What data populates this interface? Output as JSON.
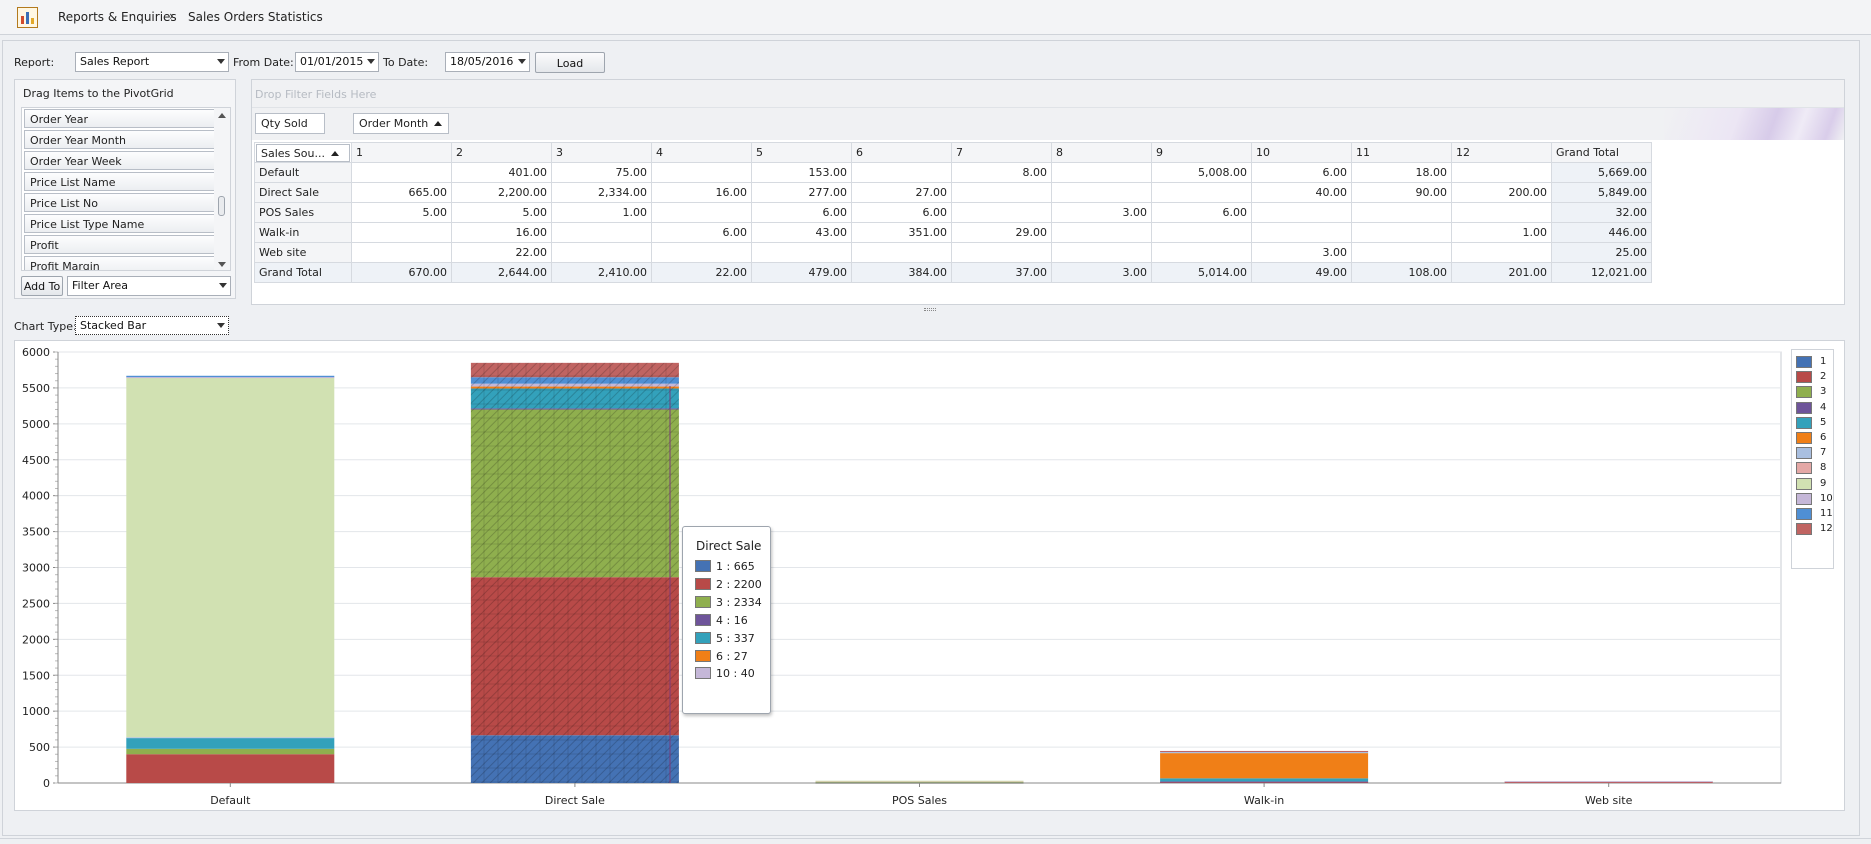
{
  "breadcrumb": {
    "root": "Reports & Enquiries",
    "separator": "›",
    "current": "Sales Orders Statistics"
  },
  "filters": {
    "report_label": "Report:",
    "report_value": "Sales Report",
    "from_label": "From Date:",
    "from_value": "01/01/2015",
    "to_label": "To Date:",
    "to_value": "18/05/2016",
    "load_label": "Load"
  },
  "field_list": {
    "title": "Drag Items to the PivotGrid",
    "items": [
      "Order Year",
      "Order Year Month",
      "Order Year Week",
      "Price List Name",
      "Price List No",
      "Price List Type Name",
      "Profit",
      "Profit Margin"
    ],
    "add_label": "Add To",
    "area_value": "Filter Area"
  },
  "pivot": {
    "filter_placeholder": "Drop Filter Fields Here",
    "data_field": "Qty Sold",
    "column_field": "Order Month",
    "row_field": "Sales Sou...",
    "columns": [
      "1",
      "2",
      "3",
      "4",
      "5",
      "6",
      "7",
      "8",
      "9",
      "10",
      "11",
      "12",
      "Grand Total"
    ],
    "rows": [
      {
        "label": "Default",
        "cells": [
          "",
          "401.00",
          "75.00",
          "",
          "153.00",
          "",
          "8.00",
          "",
          "5,008.00",
          "6.00",
          "18.00",
          "",
          "5,669.00"
        ]
      },
      {
        "label": "Direct Sale",
        "cells": [
          "665.00",
          "2,200.00",
          "2,334.00",
          "16.00",
          "277.00",
          "27.00",
          "",
          "",
          "",
          "40.00",
          "90.00",
          "200.00",
          "5,849.00"
        ]
      },
      {
        "label": "POS Sales",
        "cells": [
          "5.00",
          "5.00",
          "1.00",
          "",
          "6.00",
          "6.00",
          "",
          "3.00",
          "6.00",
          "",
          "",
          "",
          "32.00"
        ]
      },
      {
        "label": "Walk-in",
        "cells": [
          "",
          "16.00",
          "",
          "6.00",
          "43.00",
          "351.00",
          "29.00",
          "",
          "",
          "",
          "",
          "1.00",
          "446.00"
        ]
      },
      {
        "label": "Web site",
        "cells": [
          "",
          "22.00",
          "",
          "",
          "",
          "",
          "",
          "",
          "",
          "3.00",
          "",
          "",
          "25.00"
        ]
      },
      {
        "label": "Grand Total",
        "cells": [
          "670.00",
          "2,644.00",
          "2,410.00",
          "22.00",
          "479.00",
          "384.00",
          "37.00",
          "3.00",
          "5,014.00",
          "49.00",
          "108.00",
          "201.00",
          "12,021.00"
        ]
      }
    ]
  },
  "chart_type": {
    "label": "Chart Type:",
    "value": "Stacked Bar"
  },
  "chart_data": {
    "type": "bar",
    "stacked": true,
    "categories": [
      "Default",
      "Direct Sale",
      "POS Sales",
      "Walk-in",
      "Web site"
    ],
    "ylim": [
      0,
      6000
    ],
    "yticks": [
      0,
      500,
      1000,
      1500,
      2000,
      2500,
      3000,
      3500,
      4000,
      4500,
      5000,
      5500,
      6000
    ],
    "grid": true,
    "legend": "right",
    "series": [
      {
        "name": "1",
        "color": "#4472b4",
        "values": [
          0,
          665,
          5,
          0,
          0
        ]
      },
      {
        "name": "2",
        "color": "#b84a48",
        "values": [
          401,
          2200,
          5,
          16,
          22
        ]
      },
      {
        "name": "3",
        "color": "#8faf4e",
        "values": [
          75,
          2334,
          1,
          0,
          0
        ]
      },
      {
        "name": "4",
        "color": "#6e549a",
        "values": [
          0,
          16,
          0,
          6,
          0
        ]
      },
      {
        "name": "5",
        "color": "#33a1bb",
        "values": [
          153,
          277,
          6,
          43,
          0
        ]
      },
      {
        "name": "6",
        "color": "#f07f17",
        "values": [
          0,
          27,
          6,
          351,
          0
        ]
      },
      {
        "name": "7",
        "color": "#a9bfe0",
        "values": [
          8,
          0,
          0,
          29,
          0
        ]
      },
      {
        "name": "8",
        "color": "#e4a8a6",
        "values": [
          0,
          0,
          3,
          0,
          0
        ]
      },
      {
        "name": "9",
        "color": "#d1e1b2",
        "values": [
          5008,
          0,
          6,
          0,
          0
        ]
      },
      {
        "name": "10",
        "color": "#c5b7d8",
        "values": [
          6,
          40,
          0,
          0,
          3
        ]
      },
      {
        "name": "11",
        "color": "#4f8fd4",
        "values": [
          18,
          90,
          0,
          0,
          0
        ]
      },
      {
        "name": "12",
        "color": "#c06462",
        "values": [
          0,
          200,
          0,
          1,
          0
        ]
      }
    ]
  },
  "tooltip": {
    "title": "Direct Sale",
    "rows": [
      {
        "text": "1 : 665",
        "color": "#4472b4"
      },
      {
        "text": "2 : 2200",
        "color": "#b84a48"
      },
      {
        "text": "3 : 2334",
        "color": "#8faf4e"
      },
      {
        "text": "4 : 16",
        "color": "#6e549a"
      },
      {
        "text": "5 : 337",
        "color": "#33a1bb"
      },
      {
        "text": "6 : 27",
        "color": "#f07f17"
      },
      {
        "text": "10 : 40",
        "color": "#c5b7d8"
      }
    ]
  }
}
